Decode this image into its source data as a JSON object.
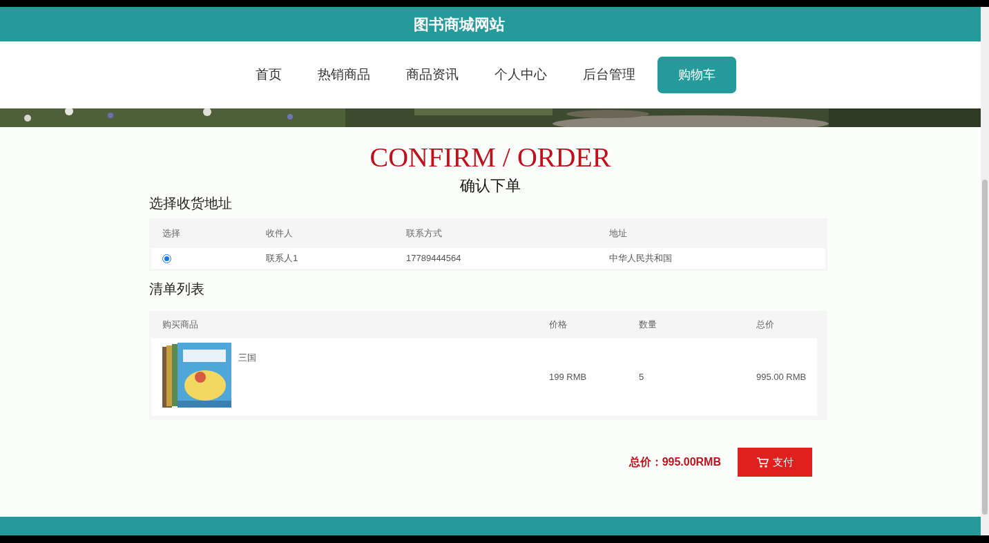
{
  "header": {
    "title": "图书商城网站"
  },
  "nav": [
    {
      "label": "首页",
      "selected": false
    },
    {
      "label": "热销商品",
      "selected": false
    },
    {
      "label": "商品资讯",
      "selected": false
    },
    {
      "label": "个人中心",
      "selected": false
    },
    {
      "label": "后台管理",
      "selected": false
    },
    {
      "label": "购物车",
      "selected": true
    }
  ],
  "heading": {
    "title": "CONFIRM / ORDER",
    "subtitle": "确认下单"
  },
  "address_section": {
    "title": "选择收货地址",
    "columns": [
      "选择",
      "收件人",
      "联系方式",
      "地址"
    ],
    "rows": [
      {
        "selected": true,
        "recipient": "联系人1",
        "phone": "17789444564",
        "address": "中华人民共和国"
      }
    ]
  },
  "list_section": {
    "title": "清单列表",
    "columns": [
      "购买商品",
      "价格",
      "数量",
      "总价"
    ],
    "rows": [
      {
        "name": "三国",
        "price": "199 RMB",
        "quantity": "5",
        "total": "995.00 RMB"
      }
    ]
  },
  "summary": {
    "total": "总价：995.00RMB",
    "pay_button": "支付"
  }
}
